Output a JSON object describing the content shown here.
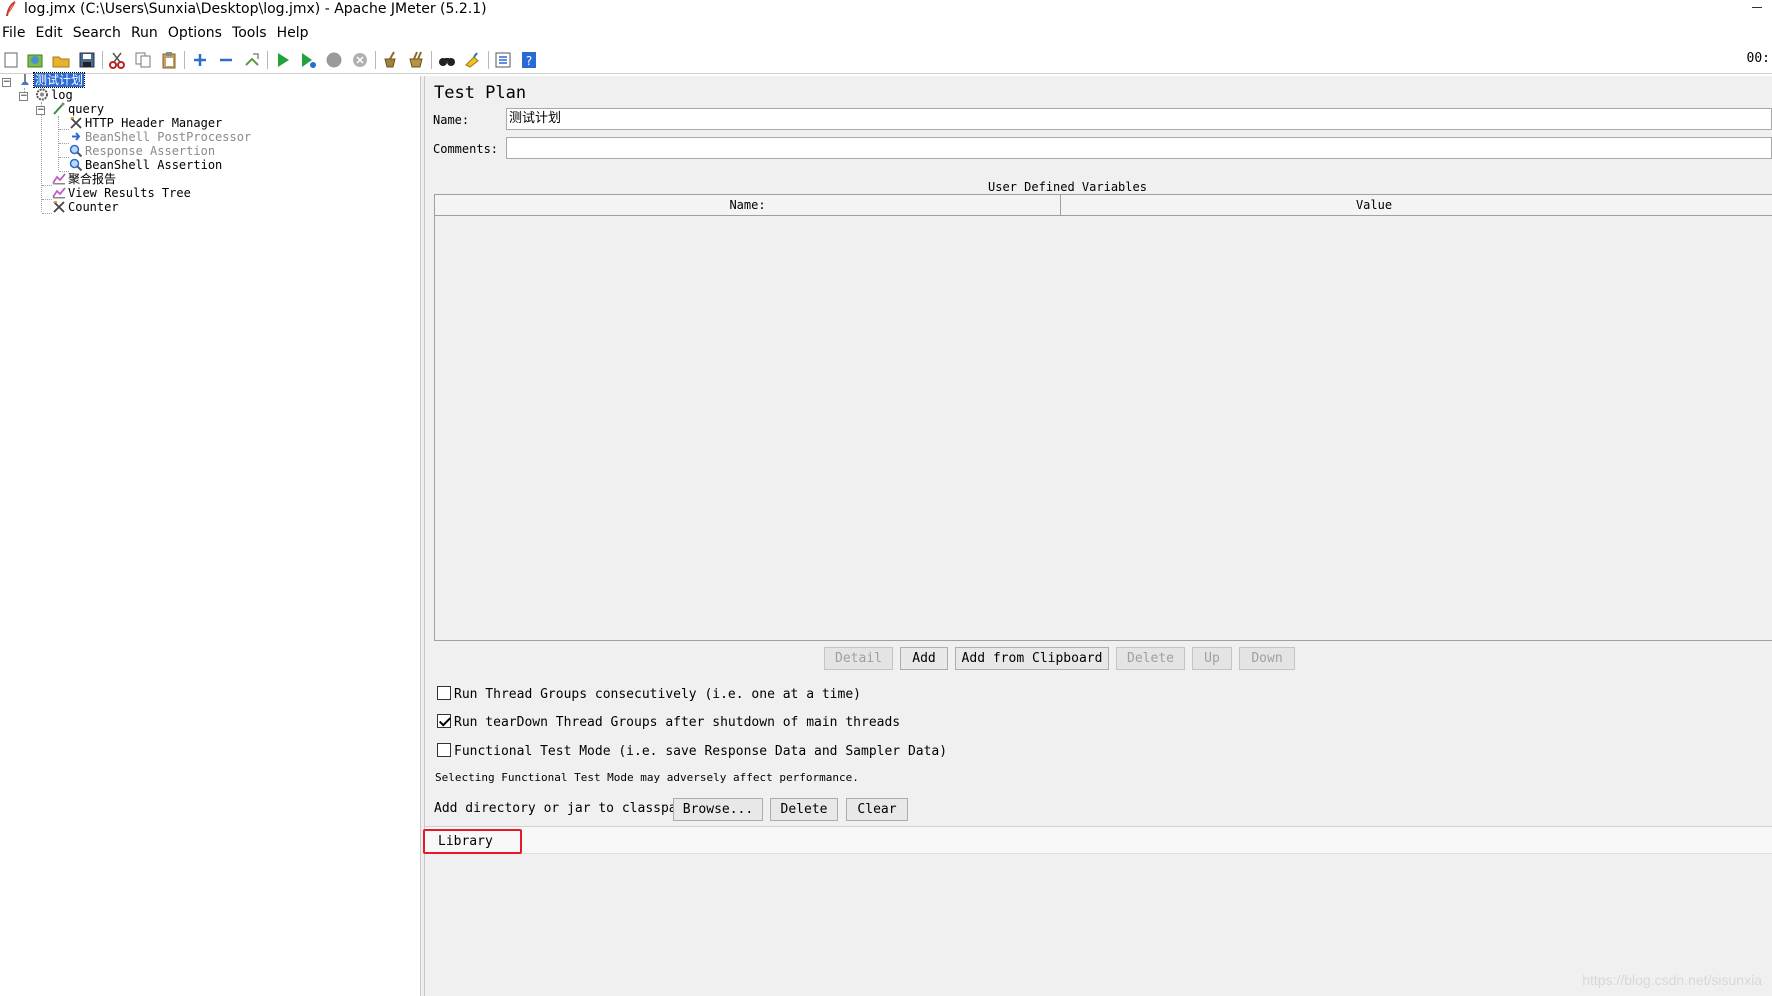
{
  "window": {
    "title": "log.jmx (C:\\Users\\Sunxia\\Desktop\\log.jmx) - Apache JMeter (5.2.1)"
  },
  "menu": [
    "File",
    "Edit",
    "Search",
    "Run",
    "Options",
    "Tools",
    "Help"
  ],
  "toolbar": {
    "clock": "00:",
    "icons": [
      "new-icon",
      "templates-icon",
      "open-icon",
      "save-icon",
      "cut-icon",
      "copy-icon",
      "paste-icon",
      "expand-icon",
      "collapse-icon",
      "toggle-icon",
      "start-icon",
      "start-no-pauses-icon",
      "stop-icon",
      "shutdown-icon",
      "clear-icon",
      "clear-all-icon",
      "search-icon",
      "reset-search-icon",
      "function-helper-icon",
      "help-icon"
    ]
  },
  "tree": {
    "nodes": [
      {
        "label": "测试计划",
        "icon": "test-plan-icon",
        "selected": true,
        "disabled": false
      },
      {
        "label": "log",
        "icon": "thread-group-icon",
        "selected": false,
        "disabled": false
      },
      {
        "label": "query",
        "icon": "sampler-icon",
        "selected": false,
        "disabled": false
      },
      {
        "label": "HTTP Header Manager",
        "icon": "config-icon",
        "selected": false,
        "disabled": false
      },
      {
        "label": "BeanShell PostProcessor",
        "icon": "postprocessor-icon",
        "selected": false,
        "disabled": true
      },
      {
        "label": "Response Assertion",
        "icon": "assertion-icon",
        "selected": false,
        "disabled": true
      },
      {
        "label": "BeanShell Assertion",
        "icon": "assertion-icon",
        "selected": false,
        "disabled": false
      },
      {
        "label": "聚合报告",
        "icon": "listener-icon",
        "selected": false,
        "disabled": false
      },
      {
        "label": "View Results Tree",
        "icon": "listener-icon",
        "selected": false,
        "disabled": false
      },
      {
        "label": "Counter",
        "icon": "config-icon",
        "selected": false,
        "disabled": false
      }
    ]
  },
  "test_plan": {
    "heading": "Test Plan",
    "name_label": "Name:",
    "name_value": "测试计划",
    "comments_label": "Comments:",
    "comments_value": "",
    "udv_title": "User Defined Variables",
    "udv_columns": [
      "Name:",
      "Value"
    ],
    "buttons": {
      "detail": "Detail",
      "add": "Add",
      "add_from_clipboard": "Add from Clipboard",
      "delete": "Delete",
      "up": "Up",
      "down": "Down"
    },
    "options": [
      {
        "label": "Run Thread Groups consecutively (i.e. one at a time)",
        "checked": false
      },
      {
        "label": "Run tearDown Thread Groups after shutdown of main threads",
        "checked": true
      },
      {
        "label": "Functional Test Mode (i.e. save Response Data and Sampler Data)",
        "checked": false
      }
    ],
    "perf_note": "Selecting Functional Test Mode may adversely affect performance.",
    "classpath_label": "Add directory or jar to classpath",
    "classpath_buttons": {
      "browse": "Browse...",
      "delete": "Delete",
      "clear": "Clear"
    },
    "library_label": "Library"
  },
  "watermark": "https://blog.csdn.net/sisunxia",
  "colors": {
    "selection": "#2a6ad4",
    "highlight": "#e8182a",
    "panel_bg": "#f0f0f0"
  }
}
